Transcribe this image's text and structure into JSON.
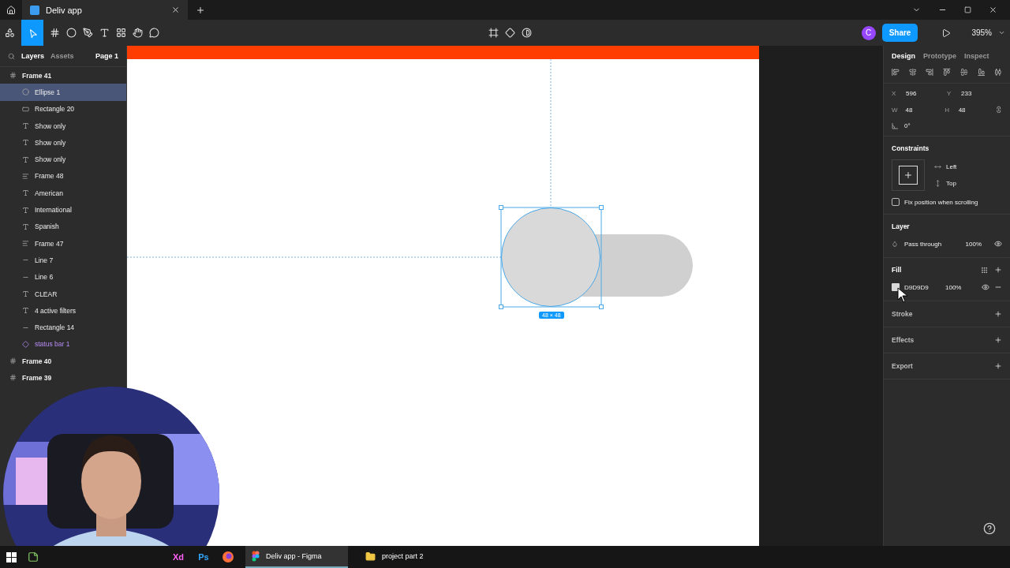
{
  "browser_tabs": [
    {
      "title": "Deliv app",
      "selected": true
    }
  ],
  "toolbar": {
    "avatar": "C",
    "share": "Share",
    "zoom": "395%"
  },
  "left_panel": {
    "tabs": [
      {
        "label": "Layers",
        "selected": true
      },
      {
        "label": "Assets",
        "selected": false
      }
    ],
    "page": "Page 1",
    "layers": [
      {
        "name": "Frame 41",
        "kind": "frame",
        "selected": false,
        "children": [
          {
            "name": "Ellipse 1",
            "kind": "ellipse",
            "selected": true
          },
          {
            "name": "Rectangle 20",
            "kind": "rectangle",
            "selected": false
          },
          {
            "name": "Show only",
            "kind": "text",
            "selected": false
          },
          {
            "name": "Show only",
            "kind": "text",
            "selected": false
          },
          {
            "name": "Show only",
            "kind": "text",
            "selected": false
          },
          {
            "name": "Frame 48",
            "kind": "autolayout",
            "selected": false
          },
          {
            "name": "American",
            "kind": "text",
            "selected": false
          },
          {
            "name": "International",
            "kind": "text",
            "selected": false
          },
          {
            "name": "Spanish",
            "kind": "text",
            "selected": false
          },
          {
            "name": "Frame 47",
            "kind": "autolayout",
            "selected": false
          },
          {
            "name": "Line 7",
            "kind": "line",
            "selected": false
          },
          {
            "name": "Line 6",
            "kind": "line",
            "selected": false
          },
          {
            "name": "CLEAR",
            "kind": "text",
            "selected": false
          },
          {
            "name": "4 active filters",
            "kind": "text",
            "selected": false
          },
          {
            "name": "Rectangle 14",
            "kind": "line",
            "selected": false
          },
          {
            "name": "status bar 1",
            "kind": "component",
            "selected": false
          }
        ]
      },
      {
        "name": "Frame 40",
        "kind": "frame",
        "selected": false
      },
      {
        "name": "Frame 39",
        "kind": "frame",
        "selected": false
      }
    ]
  },
  "canvas": {
    "size_label": "48 × 48"
  },
  "right_panel": {
    "tabs": [
      {
        "label": "Design",
        "selected": true
      },
      {
        "label": "Prototype",
        "selected": false
      },
      {
        "label": "Inspect",
        "selected": false
      }
    ],
    "fields": [
      {
        "label": "X",
        "value": "596"
      },
      {
        "label": "Y",
        "value": "233"
      },
      {
        "label": "W",
        "value": "48"
      },
      {
        "label": "H",
        "value": "48"
      }
    ],
    "rotation": "0°",
    "constraints": {
      "title": "Constraints",
      "horizontal": "Left",
      "vertical": "Top",
      "fix_label": "Fix position when scrolling",
      "checked": false
    },
    "layer": {
      "title": "Layer",
      "blend": "Pass through",
      "opacity": "100%"
    },
    "fill": {
      "title": "Fill",
      "hex": "D9D9D9",
      "opacity": "100%",
      "color": "#d9d9d9"
    },
    "sections": [
      "Stroke",
      "Effects",
      "Export"
    ]
  },
  "taskbar": {
    "apps": [
      "Xd",
      "Ps"
    ],
    "windows": [
      {
        "title": "Deliv app - Figma",
        "selected": true
      },
      {
        "title": "project part 2",
        "selected": false
      }
    ]
  }
}
